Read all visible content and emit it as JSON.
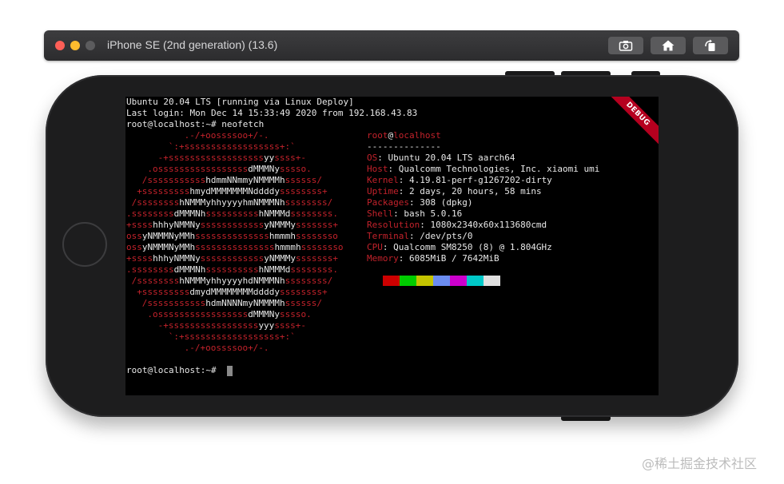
{
  "simulator": {
    "title": "iPhone SE (2nd generation) (13.6)",
    "buttons": [
      {
        "name": "screenshot-icon"
      },
      {
        "name": "home-icon"
      },
      {
        "name": "rotate-icon"
      }
    ]
  },
  "terminal": {
    "header_lines": [
      "Ubuntu 20.04 LTS [running via Linux Deploy]",
      "Last login: Mon Dec 14 15:33:49 2020 from 192.168.43.83",
      "root@localhost:~# neofetch"
    ],
    "logo_lines": [
      {
        "indent": 11,
        "text": ".-/+oossssoo+/-."
      },
      {
        "indent": 8,
        "text": "`:+ssssssssssssssssss+:`"
      },
      {
        "indent": 6,
        "text": "-+ssssssssssssssssssyyssss+-"
      },
      {
        "indent": 4,
        "text": ".osssssssssssssssssdMMMNysssso."
      },
      {
        "indent": 3,
        "text": "/ssssssssssshdmmNNmmyNMMMMhssssss/"
      },
      {
        "indent": 2,
        "text": "+ssssssssshmydMMMMMMMNddddyssssssss+"
      },
      {
        "indent": 1,
        "text": "/sssssssshNMMMyhhyyyyhmNMMMNhssssssss/"
      },
      {
        "indent": 0,
        "text": ".ssssssssdMMMNhsssssssssshNMMMdssssssss."
      },
      {
        "indent": 0,
        "text": "+sssshhhyNMMNyssssssssssssyNMMMysssssss+"
      },
      {
        "indent": 0,
        "text": "ossyNMMMNyMMhsssssssssssssshmmmhssssssso"
      },
      {
        "indent": 0,
        "text": "ossyNMMMNyMMhssssssssssssssshmmmhssssssso"
      },
      {
        "indent": 0,
        "text": "+sssshhhyNMMNyssssssssssssyNMMMysssssss+"
      },
      {
        "indent": 0,
        "text": ".ssssssssdMMMNhsssssssssshNMMMdssssssss."
      },
      {
        "indent": 1,
        "text": "/sssssssshNMMMyhhyyyyhdNMMMNhssssssss/"
      },
      {
        "indent": 2,
        "text": "+sssssssssdmydMMMMMMMMddddyssssssss+"
      },
      {
        "indent": 3,
        "text": "/ssssssssssshdmNNNNmyNMMMMhssssss/"
      },
      {
        "indent": 4,
        "text": ".osssssssssssssssssdMMMNysssso."
      },
      {
        "indent": 6,
        "text": "-+sssssssssssssssssyyyssss+-"
      },
      {
        "indent": 8,
        "text": "`:+ssssssssssssssssss+:`"
      },
      {
        "indent": 11,
        "text": ".-/+oossssoo+/-."
      }
    ],
    "user_host": {
      "user": "root",
      "at": "@",
      "host": "localhost"
    },
    "separator": "--------------",
    "info": [
      {
        "key": "OS",
        "value": "Ubuntu 20.04 LTS aarch64"
      },
      {
        "key": "Host",
        "value": "Qualcomm Technologies, Inc. xiaomi umi"
      },
      {
        "key": "Kernel",
        "value": "4.19.81-perf-g1267202-dirty"
      },
      {
        "key": "Uptime",
        "value": "2 days, 20 hours, 58 mins"
      },
      {
        "key": "Packages",
        "value": "308 (dpkg)"
      },
      {
        "key": "Shell",
        "value": "bash 5.0.16"
      },
      {
        "key": "Resolution",
        "value": "1080x2340x60x113680cmd"
      },
      {
        "key": "Terminal",
        "value": "/dev/pts/0"
      },
      {
        "key": "CPU",
        "value": "Qualcomm SM8250 (8) @ 1.804GHz"
      },
      {
        "key": "Memory",
        "value": "6085MiB / 7642MiB"
      }
    ],
    "palette": [
      "#cc0000",
      "#00cc00",
      "#c4c400",
      "#6b8cf0",
      "#cc00cc",
      "#00c8c8",
      "#e0e0e0"
    ],
    "prompt": "root@localhost:~# ",
    "debug_banner": "DEBUG"
  },
  "watermark": "@稀土掘金技术社区"
}
